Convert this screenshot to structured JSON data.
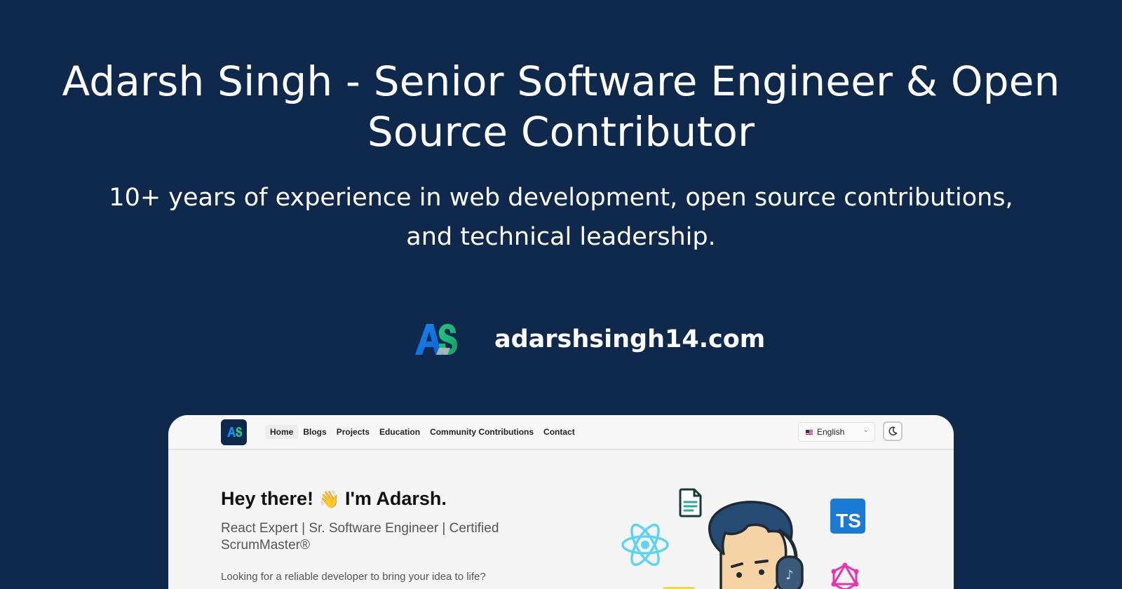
{
  "og": {
    "headline": "Adarsh Singh - Senior Software Engineer & Open Source Contributor",
    "subline": "10+ years of experience in web development, open source contributions, and technical leadership.",
    "domain": "adarshsingh14.com",
    "logo_letters": "AS",
    "background_color": "#0f294d"
  },
  "preview": {
    "nav": {
      "logo_letters": "AS",
      "links": [
        "Home",
        "Blogs",
        "Projects",
        "Education",
        "Community Contributions",
        "Contact"
      ],
      "active_link": "Home",
      "language": "English",
      "theme_icon": "moon-icon"
    },
    "hero": {
      "greeting_start": "Hey there!",
      "wave_emoji": "👋",
      "greeting_end": "I'm Adarsh.",
      "subtitle": "React Expert | Sr. Software Engineer | Certified ScrumMaster®",
      "description": "Looking for a reliable developer to bring your idea to life?"
    },
    "illustration_icons": [
      "react-icon",
      "document-icon",
      "typescript-icon",
      "graphql-icon",
      "developer-avatar"
    ],
    "typescript_badge": "TS"
  }
}
